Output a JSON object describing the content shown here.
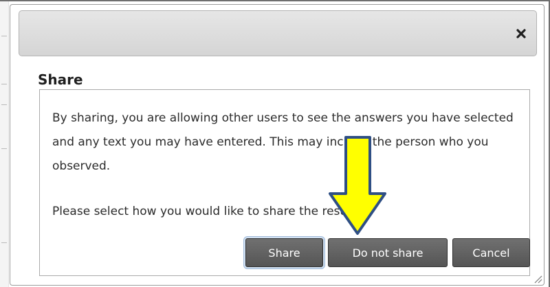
{
  "dialog": {
    "title": "Share",
    "close_icon": "close-icon",
    "message": "By sharing, you are allowing other users to see the answers you have selected and any text you may have entered. This may include the person who you observed.",
    "prompt": "Please select how you would like to share the results:",
    "buttons": {
      "share": "Share",
      "do_not_share": "Do not share",
      "cancel": "Cancel"
    }
  },
  "annotation": {
    "icon": "down-arrow-icon",
    "fill_color": "#ffff00",
    "outline_color": "#2f4f84"
  },
  "colors": {
    "button": "#5f5f5f",
    "titlebar": "#dcdcdc"
  }
}
